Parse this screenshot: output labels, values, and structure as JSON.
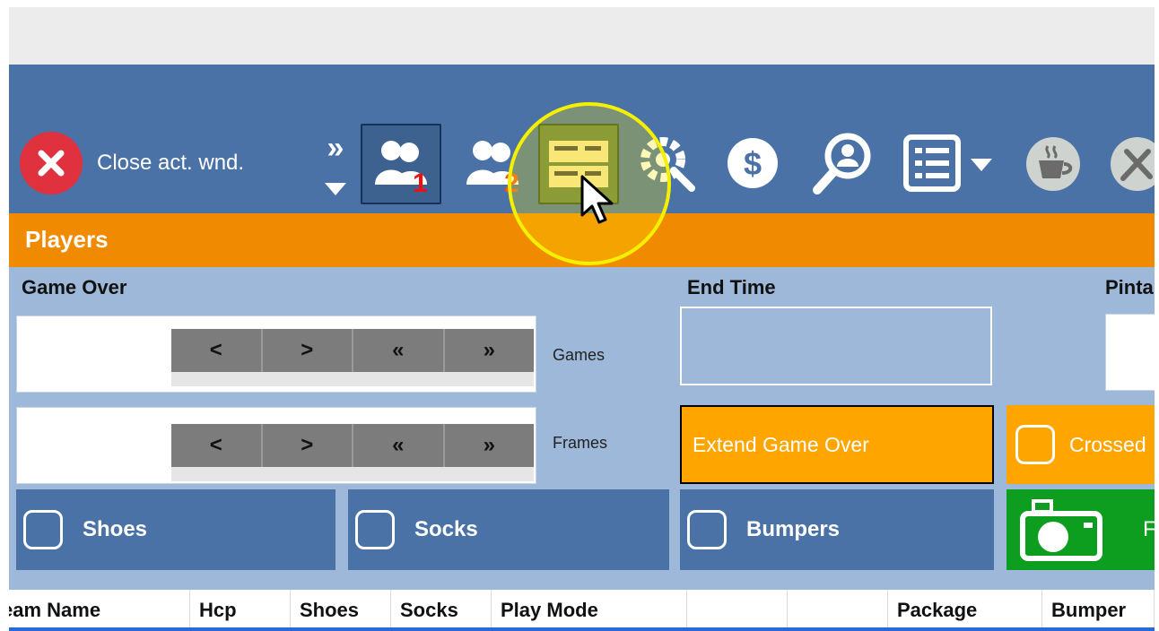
{
  "toolbar": {
    "close_label": "Close act. wnd.",
    "expand_label": "»",
    "icons": [
      "close-icon",
      "players1-icon",
      "players2-icon",
      "lanes-grid-icon",
      "settings-icon",
      "dollar-icon",
      "search-person-icon",
      "list-icon",
      "coffee-icon",
      "tools-icon"
    ]
  },
  "section": {
    "title": "Players"
  },
  "game_over": {
    "label": "Game Over",
    "rows": [
      {
        "label": "Games",
        "buttons": [
          "<",
          ">",
          "«",
          "»"
        ]
      },
      {
        "label": "Frames",
        "buttons": [
          "<",
          ">",
          "«",
          "»"
        ]
      }
    ]
  },
  "end_time": {
    "label": "End Time"
  },
  "pint": {
    "label": "Pinta"
  },
  "actions": {
    "extend_game_over": "Extend Game Over",
    "crossed": "Crossed",
    "shoes": "Shoes",
    "socks": "Socks",
    "bumpers": "Bumpers",
    "photo": "F"
  },
  "table": {
    "columns": [
      "eam Name",
      "Hcp",
      "Shoes",
      "Socks",
      "Play Mode",
      "",
      "",
      "Package",
      "Bumper"
    ]
  },
  "colors": {
    "accent_orange": "#f08a00",
    "toolbar_blue": "#4a72a6",
    "panel_blue": "#9db8d9",
    "close_red": "#e0313f",
    "highlight_yellow": "#f4f000",
    "camera_green": "#0d9e1f"
  }
}
